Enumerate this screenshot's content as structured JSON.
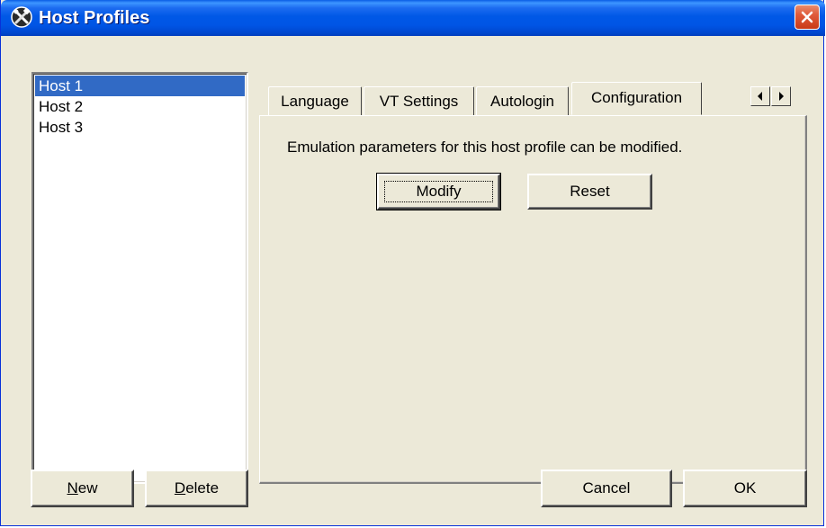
{
  "window": {
    "title": "Host Profiles",
    "title_icon": "tools-icon",
    "close_icon": "close-icon"
  },
  "host_list": {
    "items": [
      "Host 1",
      "Host 2",
      "Host 3"
    ],
    "selected_index": 0
  },
  "tabs": [
    {
      "label": "Language",
      "active": false
    },
    {
      "label": "VT Settings",
      "active": false
    },
    {
      "label": "Autologin",
      "active": false
    },
    {
      "label": "Configuration",
      "active": true
    }
  ],
  "tab_scroll": {
    "left_icon": "arrow-left-icon",
    "right_icon": "arrow-right-icon"
  },
  "configuration": {
    "description": "Emulation parameters for this host profile can be modified.",
    "modify_label": "Modify",
    "reset_label": "Reset"
  },
  "footer": {
    "new_label": "ew",
    "new_mnemonic": "N",
    "delete_label": "elete",
    "delete_mnemonic": "D",
    "cancel_label": "Cancel",
    "ok_label": "OK"
  },
  "colors": {
    "titlebar": "#0055e5",
    "selection": "#316ac5",
    "face": "#ece9d8",
    "close_button": "#e05a3a"
  }
}
